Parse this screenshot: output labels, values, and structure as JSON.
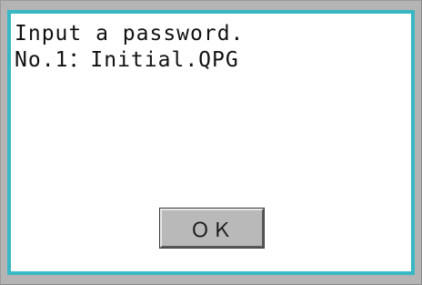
{
  "dialog": {
    "message_line1": "Input a password.",
    "message_line2": "No.1：Initial.QPG",
    "ok_label": "ＯＫ"
  },
  "colors": {
    "border_accent": "#38b8c4",
    "button_face": "#b9b9b9",
    "frame": "#b4b4b4"
  }
}
